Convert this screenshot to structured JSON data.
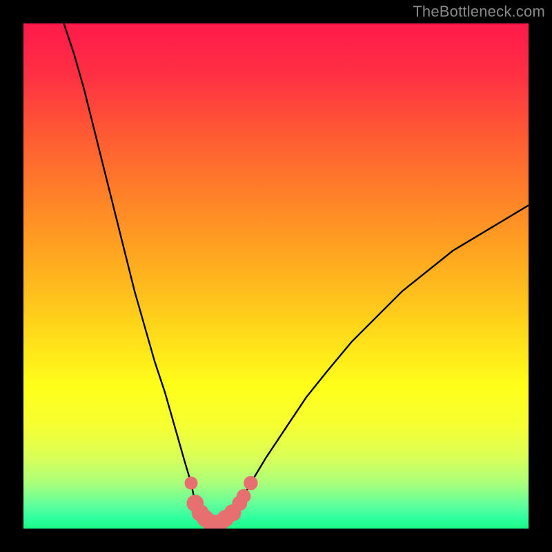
{
  "attribution": "TheBottleneck.com",
  "colors": {
    "black": "#000000",
    "curve": "#000000",
    "marker": "#e86f6f",
    "gradient_stops": [
      {
        "offset": 0.0,
        "color": "#ff1a4b"
      },
      {
        "offset": 0.1,
        "color": "#ff2f44"
      },
      {
        "offset": 0.22,
        "color": "#ff5a33"
      },
      {
        "offset": 0.35,
        "color": "#ff8427"
      },
      {
        "offset": 0.48,
        "color": "#ffad1f"
      },
      {
        "offset": 0.6,
        "color": "#ffd61a"
      },
      {
        "offset": 0.72,
        "color": "#ffff1a"
      },
      {
        "offset": 0.8,
        "color": "#f5ff33"
      },
      {
        "offset": 0.86,
        "color": "#d9ff59"
      },
      {
        "offset": 0.91,
        "color": "#aaff7a"
      },
      {
        "offset": 0.95,
        "color": "#66ff99"
      },
      {
        "offset": 0.98,
        "color": "#2effa0"
      },
      {
        "offset": 1.0,
        "color": "#1aff85"
      }
    ]
  },
  "chart_data": {
    "type": "line",
    "title": "",
    "xlabel": "",
    "ylabel": "",
    "xlim": [
      0,
      100
    ],
    "ylim": [
      0,
      100
    ],
    "grid": false,
    "series": [
      {
        "name": "bottleneck-curve",
        "x": [
          8,
          10,
          12,
          14,
          16,
          18,
          20,
          22,
          24,
          26,
          28,
          30,
          32,
          33.2,
          34,
          36,
          37,
          38,
          39,
          40,
          42.8,
          45,
          48,
          52,
          56,
          60,
          65,
          70,
          75,
          80,
          85,
          90,
          95,
          100
        ],
        "y": [
          100,
          94,
          87,
          79,
          71,
          63,
          55,
          47,
          40,
          33,
          27,
          20,
          13,
          9,
          5,
          2,
          1.2,
          1,
          1.2,
          2,
          5,
          9,
          14,
          20,
          26,
          31,
          37,
          42,
          47,
          51,
          55,
          58,
          61,
          64
        ]
      }
    ],
    "markers": {
      "name": "highlighted-points",
      "points": [
        {
          "x": 33.2,
          "y": 9,
          "r": 1.3
        },
        {
          "x": 34.0,
          "y": 5,
          "r": 1.7
        },
        {
          "x": 35.0,
          "y": 3.1,
          "r": 1.7
        },
        {
          "x": 36.0,
          "y": 2.0,
          "r": 1.7
        },
        {
          "x": 37.0,
          "y": 1.2,
          "r": 1.7
        },
        {
          "x": 38.0,
          "y": 1.0,
          "r": 1.7
        },
        {
          "x": 39.0,
          "y": 1.2,
          "r": 1.7
        },
        {
          "x": 40.0,
          "y": 2.0,
          "r": 1.7
        },
        {
          "x": 41.4,
          "y": 3.1,
          "r": 1.7
        },
        {
          "x": 42.8,
          "y": 5.0,
          "r": 1.5
        },
        {
          "x": 43.6,
          "y": 6.4,
          "r": 1.4
        },
        {
          "x": 45.0,
          "y": 9.0,
          "r": 1.4
        }
      ]
    }
  }
}
